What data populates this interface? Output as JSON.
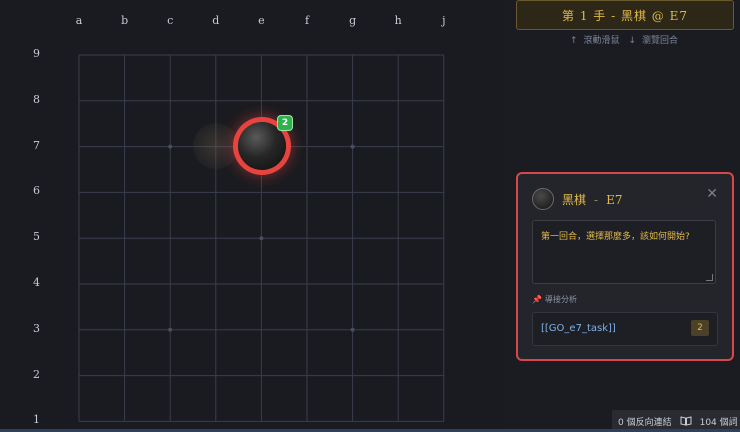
{
  "board": {
    "columns": [
      "a",
      "b",
      "c",
      "d",
      "e",
      "f",
      "g",
      "h",
      "j"
    ],
    "rows": [
      "9",
      "8",
      "7",
      "6",
      "5",
      "4",
      "3",
      "2",
      "1"
    ],
    "last_move": {
      "col": "e",
      "row": "7",
      "color": "black",
      "move_number": "2"
    },
    "ghost_stone": {
      "col": "d",
      "row": "7"
    }
  },
  "header": {
    "move_banner": "第 1 手 - 黑棋 @ E7",
    "hint_up": "↑",
    "hint_scroll": "滾動滑鼠",
    "hint_down": "↓",
    "hint_browse": "瀏覽回合"
  },
  "panel": {
    "stone_label": "黑棋",
    "separator": "-",
    "coord": "E7",
    "close": "✕",
    "note_text": "第一回合，選擇那麼多，該如何開始?",
    "section_label": "導接分析",
    "link_text": "[[GO_e7_task]]",
    "link_count": "2"
  },
  "status_bar": {
    "backlinks": "0 個反向連結",
    "words": "104 個詞"
  },
  "colors": {
    "accent": "#e2b94a",
    "highlight": "#e8443f",
    "badge": "#2fb24c",
    "link": "#7fb0e4"
  }
}
